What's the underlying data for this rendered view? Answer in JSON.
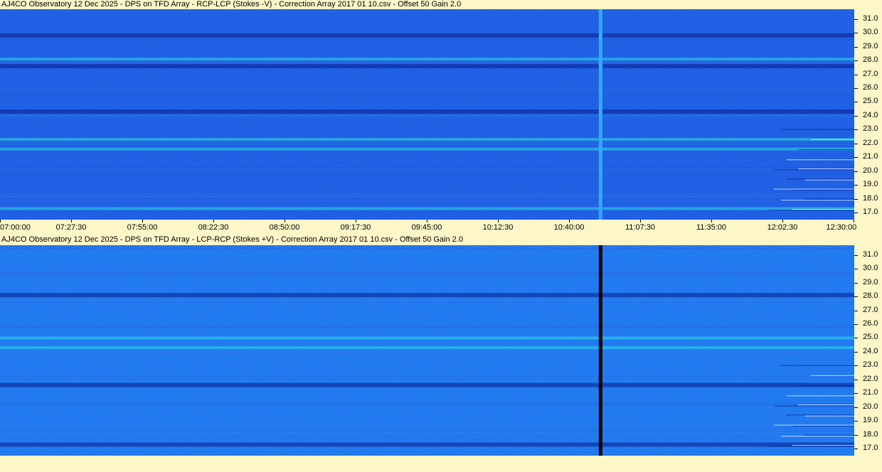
{
  "chart_data": [
    {
      "type": "heatmap",
      "title": "AJ4CO Observatory 12 Dec 2025  -  DPS on TFD Array  -  RCP-LCP (Stokes -V)  -  Correction Array 2017 01 10.csv  -  Offset 50  Gain 2.0",
      "xlabel": "",
      "ylabel": "",
      "x_tick_labels": [
        "07:00:00",
        "07:27:30",
        "07:55:00",
        "08:22:30",
        "08:50:00",
        "09:17:30",
        "09:45:00",
        "10:12:30",
        "10:40:00",
        "11:07:30",
        "11:35:00",
        "12:02:30",
        "12:30:00"
      ],
      "y_tick_labels": [
        "31.0",
        "30.0",
        "29.0",
        "28.0",
        "27.0",
        "26.0",
        "25.0",
        "24.0",
        "23.0",
        "22.0",
        "21.0",
        "20.0",
        "19.0",
        "18.0",
        "17.0"
      ],
      "ylim": [
        16.5,
        31.7
      ],
      "xlim": [
        "07:00:00",
        "12:30:00"
      ],
      "colormap": [
        "#0a1e8c",
        "#1550e6",
        "#1e90ff",
        "#2ee6e6",
        "#ffffff"
      ],
      "base_color": "#1c5ae0",
      "features": {
        "bright_bands_mhz": [
          28.1,
          22.3,
          21.6,
          17.3
        ],
        "dark_bands_mhz": [
          24.3,
          27.6,
          29.8
        ],
        "vertical_event_time": "10:52:00",
        "vertical_event_color": "#33aaff"
      }
    },
    {
      "type": "heatmap",
      "title": "AJ4CO Observatory 12 Dec 2025  -  DPS on TFD Array  -  LCP-RCP (Stokes +V)  -  Correction Array 2017 01 10.csv  -  Offset 50  Gain 2.0",
      "xlabel": "",
      "ylabel": "",
      "y_tick_labels": [
        "31.0",
        "30.0",
        "29.0",
        "28.0",
        "27.0",
        "26.0",
        "25.0",
        "24.0",
        "23.0",
        "22.0",
        "21.0",
        "20.0",
        "19.0",
        "18.0",
        "17.0"
      ],
      "ylim": [
        16.5,
        31.7
      ],
      "xlim": [
        "07:00:00",
        "12:30:00"
      ],
      "colormap": [
        "#0a1e8c",
        "#1550e6",
        "#1e90ff",
        "#2ee6e6",
        "#ffffff"
      ],
      "base_color": "#1e78ee",
      "features": {
        "bright_bands_mhz": [
          24.3,
          25.0
        ],
        "dark_bands_mhz": [
          28.1,
          21.6,
          17.3
        ],
        "vertical_event_time": "10:52:00",
        "vertical_event_color": "#000000"
      }
    }
  ]
}
